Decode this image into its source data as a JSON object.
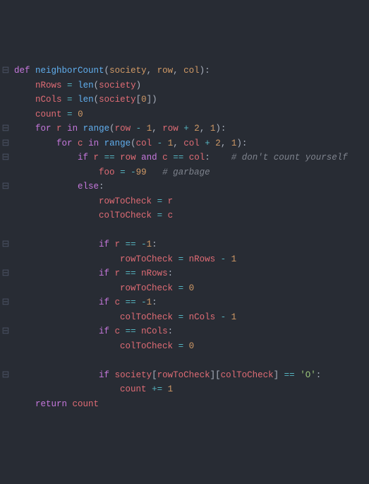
{
  "code_lines": [
    {
      "g": "⊟",
      "indent": 0,
      "tokens": [
        [
          "kw",
          "def "
        ],
        [
          "fn",
          "neighborCount"
        ],
        [
          "plain",
          "("
        ],
        [
          "param",
          "society"
        ],
        [
          "plain",
          ", "
        ],
        [
          "param",
          "row"
        ],
        [
          "plain",
          ", "
        ],
        [
          "param",
          "col"
        ],
        [
          "plain",
          "):"
        ]
      ]
    },
    {
      "g": "",
      "indent": 1,
      "tokens": [
        [
          "var",
          "nRows"
        ],
        [
          "plain",
          " "
        ],
        [
          "op",
          "="
        ],
        [
          "plain",
          " "
        ],
        [
          "fn",
          "len"
        ],
        [
          "plain",
          "("
        ],
        [
          "var",
          "society"
        ],
        [
          "plain",
          ")"
        ]
      ]
    },
    {
      "g": "",
      "indent": 1,
      "tokens": [
        [
          "var",
          "nCols"
        ],
        [
          "plain",
          " "
        ],
        [
          "op",
          "="
        ],
        [
          "plain",
          " "
        ],
        [
          "fn",
          "len"
        ],
        [
          "plain",
          "("
        ],
        [
          "var",
          "society"
        ],
        [
          "plain",
          "["
        ],
        [
          "num",
          "0"
        ],
        [
          "plain",
          "])"
        ]
      ]
    },
    {
      "g": "",
      "indent": 1,
      "tokens": [
        [
          "var",
          "count"
        ],
        [
          "plain",
          " "
        ],
        [
          "op",
          "="
        ],
        [
          "plain",
          " "
        ],
        [
          "num",
          "0"
        ]
      ]
    },
    {
      "g": "⊟",
      "indent": 1,
      "tokens": [
        [
          "kw",
          "for"
        ],
        [
          "plain",
          " "
        ],
        [
          "var",
          "r"
        ],
        [
          "plain",
          " "
        ],
        [
          "kw",
          "in"
        ],
        [
          "plain",
          " "
        ],
        [
          "fn",
          "range"
        ],
        [
          "plain",
          "("
        ],
        [
          "var",
          "row"
        ],
        [
          "plain",
          " "
        ],
        [
          "op",
          "-"
        ],
        [
          "plain",
          " "
        ],
        [
          "num",
          "1"
        ],
        [
          "plain",
          ", "
        ],
        [
          "var",
          "row"
        ],
        [
          "plain",
          " "
        ],
        [
          "op",
          "+"
        ],
        [
          "plain",
          " "
        ],
        [
          "num",
          "2"
        ],
        [
          "plain",
          ", "
        ],
        [
          "num",
          "1"
        ],
        [
          "plain",
          "):"
        ]
      ]
    },
    {
      "g": "⊟",
      "indent": 2,
      "tokens": [
        [
          "kw",
          "for"
        ],
        [
          "plain",
          " "
        ],
        [
          "var",
          "c"
        ],
        [
          "plain",
          " "
        ],
        [
          "kw",
          "in"
        ],
        [
          "plain",
          " "
        ],
        [
          "fn",
          "range"
        ],
        [
          "plain",
          "("
        ],
        [
          "var",
          "col"
        ],
        [
          "plain",
          " "
        ],
        [
          "op",
          "-"
        ],
        [
          "plain",
          " "
        ],
        [
          "num",
          "1"
        ],
        [
          "plain",
          ", "
        ],
        [
          "var",
          "col"
        ],
        [
          "plain",
          " "
        ],
        [
          "op",
          "+"
        ],
        [
          "plain",
          " "
        ],
        [
          "num",
          "2"
        ],
        [
          "plain",
          ", "
        ],
        [
          "num",
          "1"
        ],
        [
          "plain",
          "):"
        ]
      ]
    },
    {
      "g": "⊟",
      "indent": 3,
      "tokens": [
        [
          "kw",
          "if"
        ],
        [
          "plain",
          " "
        ],
        [
          "var",
          "r"
        ],
        [
          "plain",
          " "
        ],
        [
          "op",
          "=="
        ],
        [
          "plain",
          " "
        ],
        [
          "var",
          "row"
        ],
        [
          "plain",
          " "
        ],
        [
          "kw",
          "and"
        ],
        [
          "plain",
          " "
        ],
        [
          "var",
          "c"
        ],
        [
          "plain",
          " "
        ],
        [
          "op",
          "=="
        ],
        [
          "plain",
          " "
        ],
        [
          "var",
          "col"
        ],
        [
          "plain",
          ":    "
        ],
        [
          "cmt",
          "# don't count yourself"
        ]
      ]
    },
    {
      "g": "",
      "indent": 4,
      "tokens": [
        [
          "var",
          "foo"
        ],
        [
          "plain",
          " "
        ],
        [
          "op",
          "="
        ],
        [
          "plain",
          " "
        ],
        [
          "op",
          "-"
        ],
        [
          "num",
          "99"
        ],
        [
          "plain",
          "   "
        ],
        [
          "cmt",
          "# garbage"
        ]
      ]
    },
    {
      "g": "⊟",
      "indent": 3,
      "tokens": [
        [
          "kw",
          "else"
        ],
        [
          "plain",
          ":"
        ]
      ]
    },
    {
      "g": "",
      "indent": 4,
      "tokens": [
        [
          "var",
          "rowToCheck"
        ],
        [
          "plain",
          " "
        ],
        [
          "op",
          "="
        ],
        [
          "plain",
          " "
        ],
        [
          "var",
          "r"
        ]
      ]
    },
    {
      "g": "",
      "indent": 4,
      "tokens": [
        [
          "var",
          "colToCheck"
        ],
        [
          "plain",
          " "
        ],
        [
          "op",
          "="
        ],
        [
          "plain",
          " "
        ],
        [
          "var",
          "c"
        ]
      ]
    },
    {
      "g": "",
      "indent": 4,
      "tokens": [
        [
          "plain",
          ""
        ]
      ]
    },
    {
      "g": "⊟",
      "indent": 4,
      "tokens": [
        [
          "kw",
          "if"
        ],
        [
          "plain",
          " "
        ],
        [
          "var",
          "r"
        ],
        [
          "plain",
          " "
        ],
        [
          "op",
          "=="
        ],
        [
          "plain",
          " "
        ],
        [
          "op",
          "-"
        ],
        [
          "num",
          "1"
        ],
        [
          "plain",
          ":"
        ]
      ]
    },
    {
      "g": "",
      "indent": 5,
      "tokens": [
        [
          "var",
          "rowToCheck"
        ],
        [
          "plain",
          " "
        ],
        [
          "op",
          "="
        ],
        [
          "plain",
          " "
        ],
        [
          "var",
          "nRows"
        ],
        [
          "plain",
          " "
        ],
        [
          "op",
          "-"
        ],
        [
          "plain",
          " "
        ],
        [
          "num",
          "1"
        ]
      ]
    },
    {
      "g": "⊟",
      "indent": 4,
      "tokens": [
        [
          "kw",
          "if"
        ],
        [
          "plain",
          " "
        ],
        [
          "var",
          "r"
        ],
        [
          "plain",
          " "
        ],
        [
          "op",
          "=="
        ],
        [
          "plain",
          " "
        ],
        [
          "var",
          "nRows"
        ],
        [
          "plain",
          ":"
        ]
      ]
    },
    {
      "g": "",
      "indent": 5,
      "tokens": [
        [
          "var",
          "rowToCheck"
        ],
        [
          "plain",
          " "
        ],
        [
          "op",
          "="
        ],
        [
          "plain",
          " "
        ],
        [
          "num",
          "0"
        ]
      ]
    },
    {
      "g": "⊟",
      "indent": 4,
      "tokens": [
        [
          "kw",
          "if"
        ],
        [
          "plain",
          " "
        ],
        [
          "var",
          "c"
        ],
        [
          "plain",
          " "
        ],
        [
          "op",
          "=="
        ],
        [
          "plain",
          " "
        ],
        [
          "op",
          "-"
        ],
        [
          "num",
          "1"
        ],
        [
          "plain",
          ":"
        ]
      ]
    },
    {
      "g": "",
      "indent": 5,
      "tokens": [
        [
          "var",
          "colToCheck"
        ],
        [
          "plain",
          " "
        ],
        [
          "op",
          "="
        ],
        [
          "plain",
          " "
        ],
        [
          "var",
          "nCols"
        ],
        [
          "plain",
          " "
        ],
        [
          "op",
          "-"
        ],
        [
          "plain",
          " "
        ],
        [
          "num",
          "1"
        ]
      ]
    },
    {
      "g": "⊟",
      "indent": 4,
      "tokens": [
        [
          "kw",
          "if"
        ],
        [
          "plain",
          " "
        ],
        [
          "var",
          "c"
        ],
        [
          "plain",
          " "
        ],
        [
          "op",
          "=="
        ],
        [
          "plain",
          " "
        ],
        [
          "var",
          "nCols"
        ],
        [
          "plain",
          ":"
        ]
      ]
    },
    {
      "g": "",
      "indent": 5,
      "tokens": [
        [
          "var",
          "colToCheck"
        ],
        [
          "plain",
          " "
        ],
        [
          "op",
          "="
        ],
        [
          "plain",
          " "
        ],
        [
          "num",
          "0"
        ]
      ]
    },
    {
      "g": "",
      "indent": 4,
      "tokens": [
        [
          "plain",
          ""
        ]
      ]
    },
    {
      "g": "⊟",
      "indent": 4,
      "tokens": [
        [
          "kw",
          "if"
        ],
        [
          "plain",
          " "
        ],
        [
          "var",
          "society"
        ],
        [
          "plain",
          "["
        ],
        [
          "var",
          "rowToCheck"
        ],
        [
          "plain",
          "]["
        ],
        [
          "var",
          "colToCheck"
        ],
        [
          "plain",
          "] "
        ],
        [
          "op",
          "=="
        ],
        [
          "plain",
          " "
        ],
        [
          "str",
          "'O'"
        ],
        [
          "plain",
          ":"
        ]
      ]
    },
    {
      "g": "",
      "indent": 5,
      "tokens": [
        [
          "var",
          "count"
        ],
        [
          "plain",
          " "
        ],
        [
          "op",
          "+="
        ],
        [
          "plain",
          " "
        ],
        [
          "num",
          "1"
        ]
      ]
    },
    {
      "g": "",
      "indent": 0,
      "tokens": [
        [
          "plain",
          ""
        ]
      ]
    },
    {
      "g": "",
      "indent": 1,
      "tokens": [
        [
          "kw",
          "return"
        ],
        [
          "plain",
          " "
        ],
        [
          "var",
          "count"
        ]
      ]
    }
  ]
}
